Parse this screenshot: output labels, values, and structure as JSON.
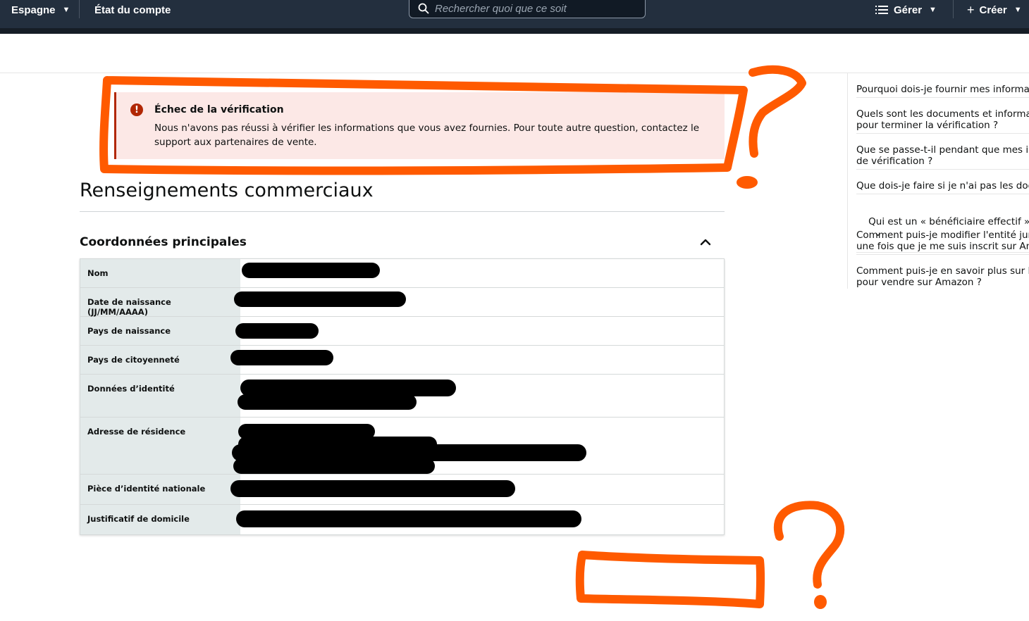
{
  "nav": {
    "region": "Espagne",
    "account_status": "État du compte",
    "search_placeholder": "Rechercher quoi que ce soit",
    "manage": "Gérer",
    "create": "Créer"
  },
  "alert": {
    "title": "Échec de la vérification",
    "body": "Nous n'avons pas réussi à vérifier les informations que vous avez fournies. Pour toute autre question, contactez le support aux partenaires de vente."
  },
  "main": {
    "title": "Renseignements commerciaux",
    "section_title": "Coordonnées principales",
    "rows": [
      {
        "label": "Nom"
      },
      {
        "label": "Date de naissance (JJ/MM/AAAA)"
      },
      {
        "label": "Pays de naissance"
      },
      {
        "label": "Pays de citoyenneté"
      },
      {
        "label": "Données d’identité"
      },
      {
        "label": "Adresse de résidence"
      },
      {
        "label": "Pièce d’identité nationale"
      },
      {
        "label": "Justificatif de domicile"
      }
    ]
  },
  "help": {
    "items": [
      "Pourquoi dois-je fournir mes informati",
      "Quels sont les documents et informati\npour terminer la vérification ?",
      "Que se passe-t-il pendant que mes info\nde vérification ?",
      "Que dois-je faire si je n'ai pas les docu",
      "Qui est un « bénéficiaire effectif » ?",
      "Comment puis-je modifier l'entité juric\nune fois que je me suis inscrit sur Ama",
      "Comment puis-je en savoir plus sur les\npour vendre sur Amazon ?"
    ]
  },
  "colors": {
    "nav_bg": "#232f3e",
    "alert_bg": "#fce8e6",
    "alert_accent": "#b12704",
    "label_bg": "#e3eaea",
    "annotation": "#ff5a00"
  }
}
